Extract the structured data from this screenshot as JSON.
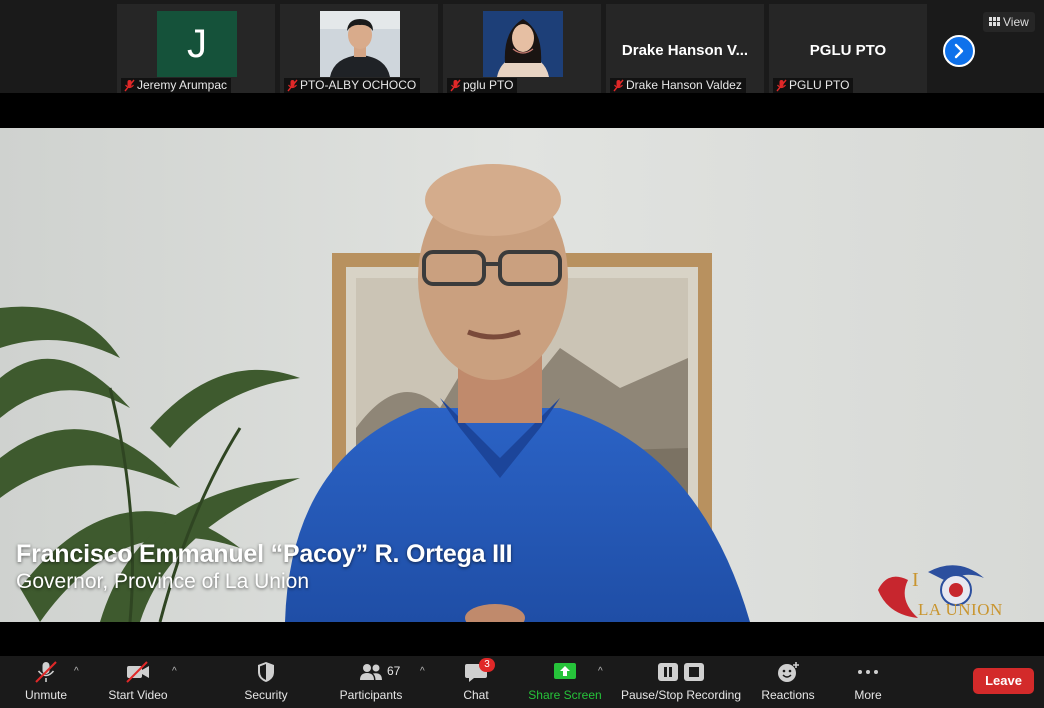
{
  "filmstrip": {
    "tiles": [
      {
        "name": "Jeremy Arumpac",
        "avatar_letter": "J",
        "hand_raised": true
      },
      {
        "name": "PTO-ALBY OCHOCO"
      },
      {
        "name": "pglu PTO"
      },
      {
        "title": "Drake Hanson V...",
        "name": "Drake Hanson Valdez"
      },
      {
        "title": "PGLU PTO",
        "name": "PGLU PTO"
      }
    ],
    "view_label": "View",
    "hand_icon": "raised-hand-icon",
    "next_icon": "chevron-right-icon"
  },
  "main": {
    "speaker_name": "Francisco Emmanuel “Pacoy” R. Ortega III",
    "speaker_title": "Governor, Province of La Union",
    "logo_text": "LA UNION"
  },
  "toolbar": {
    "unmute": "Unmute",
    "start_video": "Start Video",
    "security": "Security",
    "participants": "Participants",
    "participant_count": "67",
    "chat": "Chat",
    "chat_badge": "3",
    "share_screen": "Share Screen",
    "recording": "Pause/Stop Recording",
    "reactions": "Reactions",
    "more": "More",
    "leave": "Leave"
  },
  "colors": {
    "toolbar_bg": "#1a1a1a",
    "share_green": "#26c33a",
    "leave_red": "#d32a2a",
    "accent_blue": "#0e71eb",
    "muted_red": "#e02828"
  }
}
